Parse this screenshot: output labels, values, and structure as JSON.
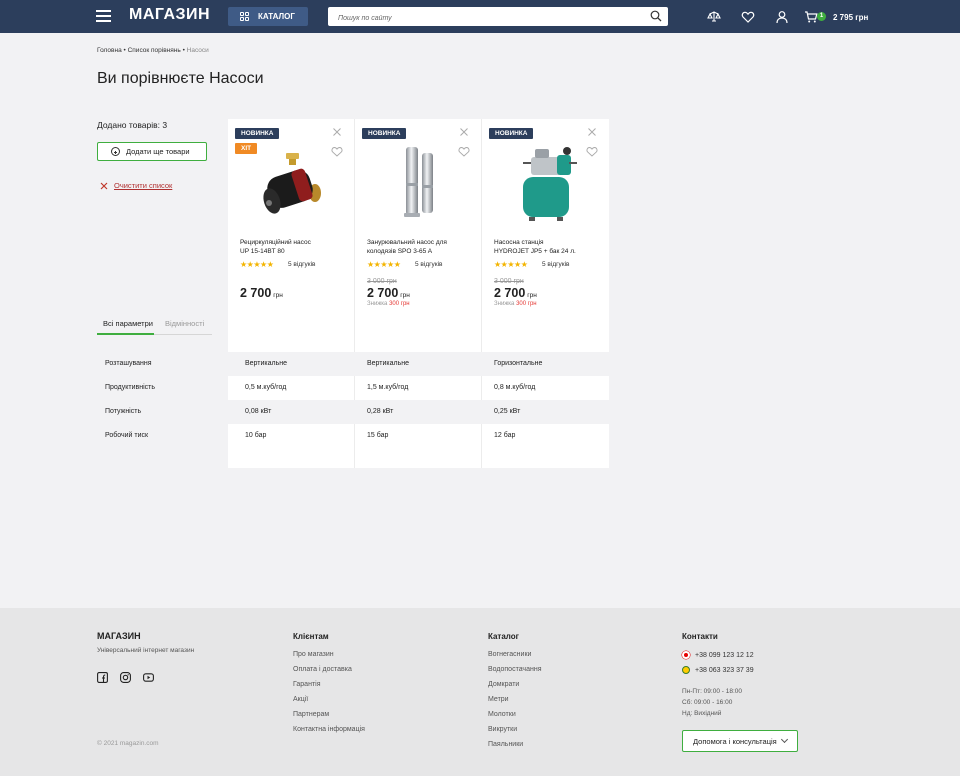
{
  "header": {
    "logo": "МАГАЗИН",
    "catalog_label": "КАТАЛОГ",
    "search_placeholder": "Пошук по сайту",
    "cart_count": "1",
    "cart_total": "2 795 грн"
  },
  "breadcrumb": {
    "home": "Головна",
    "sep": " • ",
    "compare_list": "Список порівнянь",
    "current": "Насоси"
  },
  "page_title": "Ви порівнюєте Насоси",
  "sidebar": {
    "added_text": "Додано товарів: 3",
    "add_more_label": "Додати ще товари",
    "clear_label": "Очистити список"
  },
  "tabs": {
    "all_params": "Всі параметри",
    "differences": "Відмінності"
  },
  "products": [
    {
      "badges": [
        "НОВИНКА",
        "ХІТ"
      ],
      "name_line1": "Рециркуляційний насос",
      "name_line2": "UP 15-14BT 80",
      "stars": "★★★★★",
      "reviews": "5 відгуків",
      "old_price": "",
      "price": "2 700",
      "currency": "грн",
      "discount_label": "",
      "discount_value": ""
    },
    {
      "badges": [
        "НОВИНКА"
      ],
      "name_line1": "Занурювальний насос для",
      "name_line2": "колодязів SPO 3-65 A",
      "stars": "★★★★★",
      "reviews": "5 відгуків",
      "old_price": "3 000 грн",
      "price": "2 700",
      "currency": "грн",
      "discount_label": "Знижка",
      "discount_value": "300 грн"
    },
    {
      "badges": [
        "НОВИНКА"
      ],
      "name_line1": "Насосна станція",
      "name_line2": "HYDROJET JP5 + бак 24 л.",
      "stars": "★★★★★",
      "reviews": "5 відгуків",
      "old_price": "3 000 грн",
      "price": "2 700",
      "currency": "грн",
      "discount_label": "Знижка",
      "discount_value": "300 грн"
    }
  ],
  "specs": [
    {
      "label": "Розташування",
      "values": [
        "Вертикальне",
        "Вертикальне",
        "Горизонтальне"
      ]
    },
    {
      "label": "Продуктивність",
      "values": [
        "0,5 м.куб/год",
        "1,5 м.куб/год",
        "0,8 м.куб/год"
      ]
    },
    {
      "label": "Потужність",
      "values": [
        "0,08 кВт",
        "0,28 кВт",
        "0,25 кВт"
      ]
    },
    {
      "label": "Робочий тиск",
      "values": [
        "10 бар",
        "15 бар",
        "12 бар"
      ]
    }
  ],
  "footer": {
    "logo": "МАГАЗИН",
    "subtitle": "Універсальний інтернет магазин",
    "copyright": "© 2021 magazin.com",
    "clients_title": "Клієнтам",
    "clients_links": [
      "Про магазин",
      "Оплата і доставка",
      "Гарантія",
      "Акції",
      "Партнерам",
      "Контактна інформація"
    ],
    "catalog_title": "Каталог",
    "catalog_links": [
      "Вогнегасники",
      "Водопостачання",
      "Домкрати",
      "Метри",
      "Молотки",
      "Викрутки",
      "Паяльники"
    ],
    "contacts_title": "Контакти",
    "phone1": "+38 099 123 12 12",
    "phone2": "+38 063 323 37 39",
    "hours1": "Пн-Пт: 09:00 - 18:00",
    "hours2": "Сб: 09:00 - 16:00",
    "hours3": "Нд: Вихідний",
    "help_label": "Допомога і консультація"
  },
  "colors": {
    "header_bg": "#2c3e5c",
    "accent_green": "#3fae3f",
    "badge_new": "#2c3e5c",
    "badge_hit": "#f08a24",
    "discount_red": "#e53935"
  }
}
